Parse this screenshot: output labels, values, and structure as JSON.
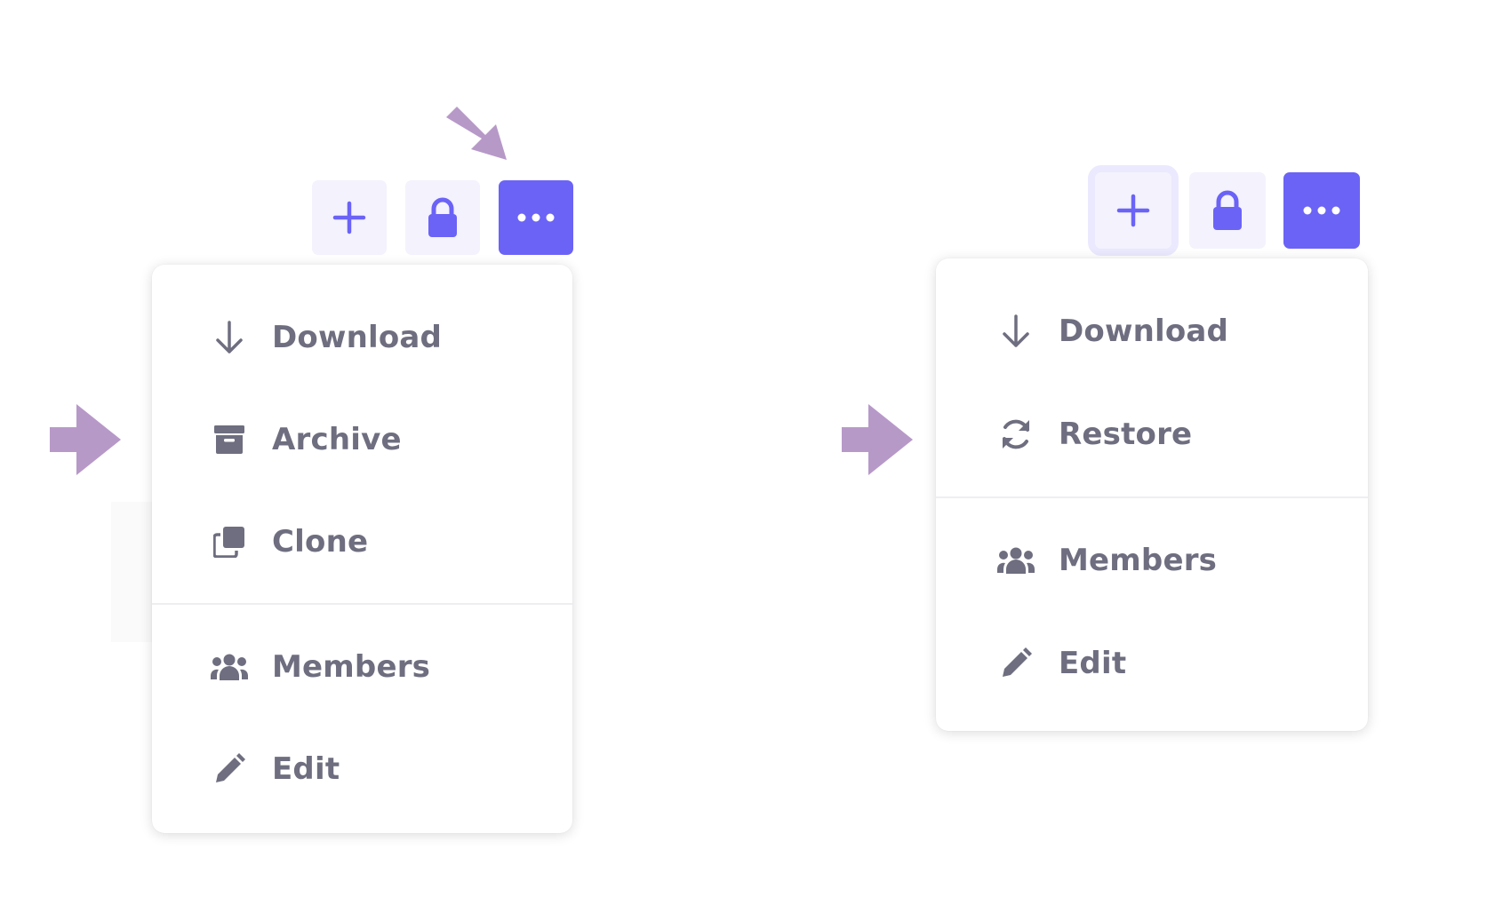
{
  "colors": {
    "accent": "#6b63f6",
    "button_bg": "#f3f2fd",
    "icon_gray": "#6e6e80",
    "pointer_arrow": "#b799c8"
  },
  "left_panel": {
    "toolbar": [
      {
        "name": "add",
        "icon": "plus-icon"
      },
      {
        "name": "lock",
        "icon": "lock-icon"
      },
      {
        "name": "more",
        "icon": "ellipsis-icon",
        "active": true
      }
    ],
    "menu": {
      "groups": [
        [
          {
            "label": "Download",
            "icon": "download-icon"
          },
          {
            "label": "Archive",
            "icon": "archive-icon"
          },
          {
            "label": "Clone",
            "icon": "clone-icon"
          }
        ],
        [
          {
            "label": "Members",
            "icon": "members-icon"
          },
          {
            "label": "Edit",
            "icon": "pencil-icon"
          }
        ]
      ]
    }
  },
  "right_panel": {
    "toolbar": [
      {
        "name": "add",
        "icon": "plus-icon",
        "focused": true
      },
      {
        "name": "lock",
        "icon": "lock-icon"
      },
      {
        "name": "more",
        "icon": "ellipsis-icon",
        "active": true
      }
    ],
    "menu": {
      "groups": [
        [
          {
            "label": "Download",
            "icon": "download-icon"
          },
          {
            "label": "Restore",
            "icon": "restore-icon"
          }
        ],
        [
          {
            "label": "Members",
            "icon": "members-icon"
          },
          {
            "label": "Edit",
            "icon": "pencil-icon"
          }
        ]
      ]
    }
  }
}
